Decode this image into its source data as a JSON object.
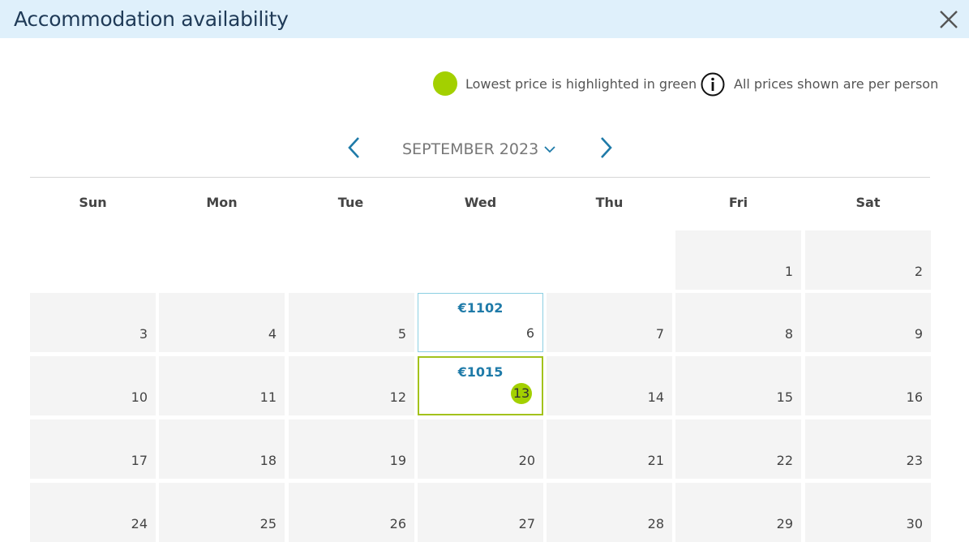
{
  "header": {
    "title": "Accommodation availability",
    "close_icon": "close-icon"
  },
  "legend": {
    "lowest_price_text": "Lowest price is highlighted in green",
    "per_person_text": "All prices shown are per person",
    "lowest_color": "#a3d000",
    "info_icon": "info-icon"
  },
  "month_nav": {
    "month_label": "SEPTEMBER 2023",
    "prev_icon": "chevron-left-icon",
    "next_icon": "chevron-right-icon",
    "dropdown_icon": "chevron-down-icon"
  },
  "weekdays": [
    "Sun",
    "Mon",
    "Tue",
    "Wed",
    "Thu",
    "Fri",
    "Sat"
  ],
  "days": [
    {
      "day": "1"
    },
    {
      "day": "2"
    },
    {
      "day": "3"
    },
    {
      "day": "4"
    },
    {
      "day": "5"
    },
    {
      "day": "6",
      "price": "€1102",
      "status": "available"
    },
    {
      "day": "7"
    },
    {
      "day": "8"
    },
    {
      "day": "9"
    },
    {
      "day": "10"
    },
    {
      "day": "11"
    },
    {
      "day": "12"
    },
    {
      "day": "13",
      "price": "€1015",
      "status": "lowest"
    },
    {
      "day": "14"
    },
    {
      "day": "15"
    },
    {
      "day": "16"
    },
    {
      "day": "17"
    },
    {
      "day": "18"
    },
    {
      "day": "19"
    },
    {
      "day": "20"
    },
    {
      "day": "21"
    },
    {
      "day": "22"
    },
    {
      "day": "23"
    },
    {
      "day": "24"
    },
    {
      "day": "25"
    },
    {
      "day": "26"
    },
    {
      "day": "27"
    },
    {
      "day": "28"
    },
    {
      "day": "29"
    },
    {
      "day": "30"
    }
  ],
  "colors": {
    "header_bg": "#dff0fb",
    "price_text": "#1e7aa8",
    "available_border": "#8ccfe2",
    "lowest_border": "#a3c21c"
  }
}
